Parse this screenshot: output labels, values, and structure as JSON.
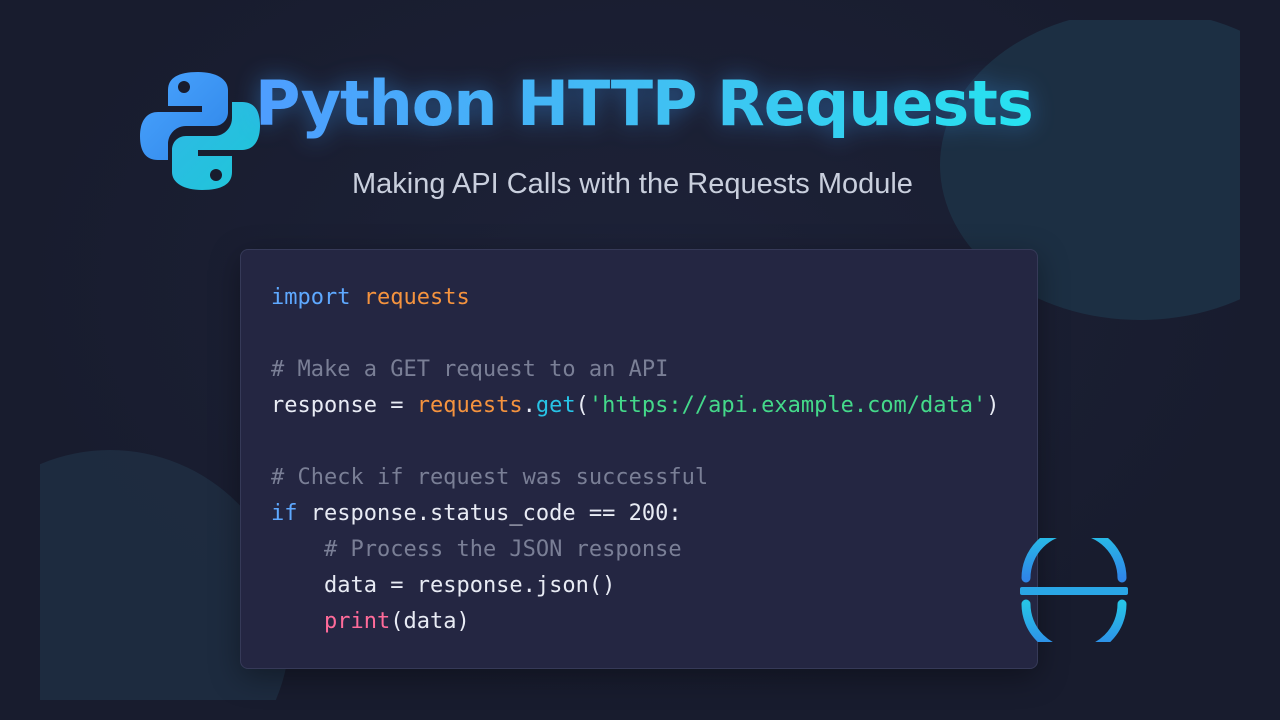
{
  "header": {
    "title": "Python HTTP Requests",
    "subtitle": "Making API Calls with the Requests Module"
  },
  "code": {
    "lines": [
      [
        {
          "text": "import",
          "kind": "keyword"
        },
        {
          "text": " ",
          "kind": "plain"
        },
        {
          "text": "requests",
          "kind": "module"
        }
      ],
      [],
      [
        {
          "text": "# Make a GET request to an API",
          "kind": "comment"
        }
      ],
      [
        {
          "text": "response = ",
          "kind": "plain"
        },
        {
          "text": "requests",
          "kind": "module"
        },
        {
          "text": ".",
          "kind": "plain"
        },
        {
          "text": "get",
          "kind": "function"
        },
        {
          "text": "(",
          "kind": "plain"
        },
        {
          "text": "'https://api.example.com/data'",
          "kind": "string"
        },
        {
          "text": ")",
          "kind": "plain"
        }
      ],
      [],
      [
        {
          "text": "# Check if request was successful",
          "kind": "comment"
        }
      ],
      [
        {
          "text": "if",
          "kind": "keyword"
        },
        {
          "text": " response.status_code == ",
          "kind": "plain"
        },
        {
          "text": "200",
          "kind": "number"
        },
        {
          "text": ":",
          "kind": "plain"
        }
      ],
      [
        {
          "text": "",
          "kind": "indent"
        },
        {
          "text": "# Process the JSON response",
          "kind": "comment"
        }
      ],
      [
        {
          "text": "",
          "kind": "indent"
        },
        {
          "text": "data = response.json()",
          "kind": "plain"
        }
      ],
      [
        {
          "text": "",
          "kind": "indent"
        },
        {
          "text": "print",
          "kind": "builtin"
        },
        {
          "text": "(data)",
          "kind": "plain"
        }
      ]
    ]
  },
  "icons": {
    "logo": "python-logo-icon",
    "corner": "sliced-circle-icon"
  },
  "colors": {
    "background": "#181c2e",
    "code_background": "#242642",
    "keyword": "#5ea8ff",
    "module": "#f5933e",
    "function": "#27c3e6",
    "string": "#44d98a",
    "comment": "#7a7f96",
    "builtin": "#ff6b9a",
    "plain": "#e8ebf4",
    "title_start": "#4e9dff",
    "title_end": "#27e2f0"
  }
}
